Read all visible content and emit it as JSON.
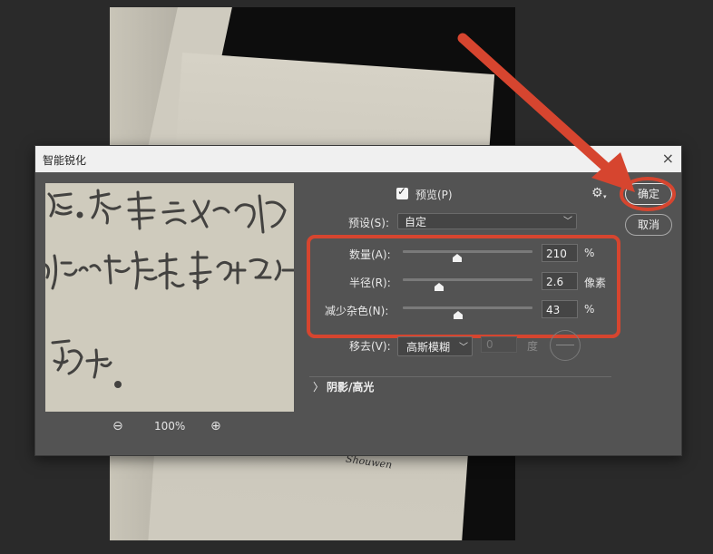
{
  "dialog": {
    "title": "智能锐化",
    "close_icon": "×"
  },
  "preview_pane": {
    "zoom_value": "100%"
  },
  "options": {
    "preview_label": "预览(P)",
    "preview_checked": true,
    "preset_label": "预设(S):",
    "preset_value": "自定",
    "gear_icon": "⚙"
  },
  "sliders": {
    "amount": {
      "label": "数量(A):",
      "value": "210",
      "unit": "%"
    },
    "radius": {
      "label": "半径(R):",
      "value": "2.6",
      "unit": "像素"
    },
    "noise": {
      "label": "减少杂色(N):",
      "value": "43",
      "unit": "%"
    }
  },
  "remove": {
    "label": "移去(V):",
    "value": "高斯模糊",
    "angle_value": "0",
    "angle_unit": "度"
  },
  "shadows_section": {
    "label": "阴影/高光",
    "expander_icon": "〉"
  },
  "buttons": {
    "ok": "确定",
    "cancel": "取消"
  },
  "colors": {
    "highlight": "#d6452f",
    "dialog_bg": "#535353"
  }
}
